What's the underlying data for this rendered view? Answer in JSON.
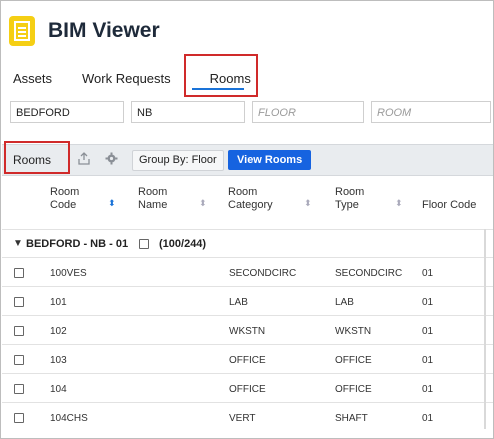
{
  "app": {
    "title": "BIM Viewer",
    "icon": "document-icon"
  },
  "tabs": [
    {
      "label": "Assets",
      "active": false
    },
    {
      "label": "Work Requests",
      "active": false
    },
    {
      "label": "Rooms",
      "active": true
    }
  ],
  "filters": {
    "site": "BEDFORD",
    "building": "NB",
    "floor_placeholder": "FLOOR",
    "room_placeholder": "ROOM"
  },
  "toolbar": {
    "rooms_label": "Rooms",
    "export_icon": "export-icon",
    "settings_icon": "gear-icon",
    "group_by_label": "Group By: Floor",
    "view_rooms_label": "View Rooms"
  },
  "columns": [
    {
      "line1": "Room",
      "line2": "Code"
    },
    {
      "line1": "Room",
      "line2": "Name"
    },
    {
      "line1": "Room",
      "line2": "Category"
    },
    {
      "line1": "Room",
      "line2": "Type"
    },
    {
      "line1": "Floor Code",
      "line2": ""
    }
  ],
  "group": {
    "label": "BEDFORD - NB - 01",
    "count": "(100/244)"
  },
  "rows": [
    {
      "code": "100VES",
      "name": "",
      "category": "SECONDCIRC",
      "type": "SECONDCIRC",
      "floor": "01"
    },
    {
      "code": "101",
      "name": "",
      "category": "LAB",
      "type": "LAB",
      "floor": "01"
    },
    {
      "code": "102",
      "name": "",
      "category": "WKSTN",
      "type": "WKSTN",
      "floor": "01"
    },
    {
      "code": "103",
      "name": "",
      "category": "OFFICE",
      "type": "OFFICE",
      "floor": "01"
    },
    {
      "code": "104",
      "name": "",
      "category": "OFFICE",
      "type": "OFFICE",
      "floor": "01"
    },
    {
      "code": "104CHS",
      "name": "",
      "category": "VERT",
      "type": "SHAFT",
      "floor": "01"
    }
  ],
  "colors": {
    "accent": "#1663e0",
    "highlight": "#d02a2a",
    "app_icon": "#f5cf14"
  }
}
